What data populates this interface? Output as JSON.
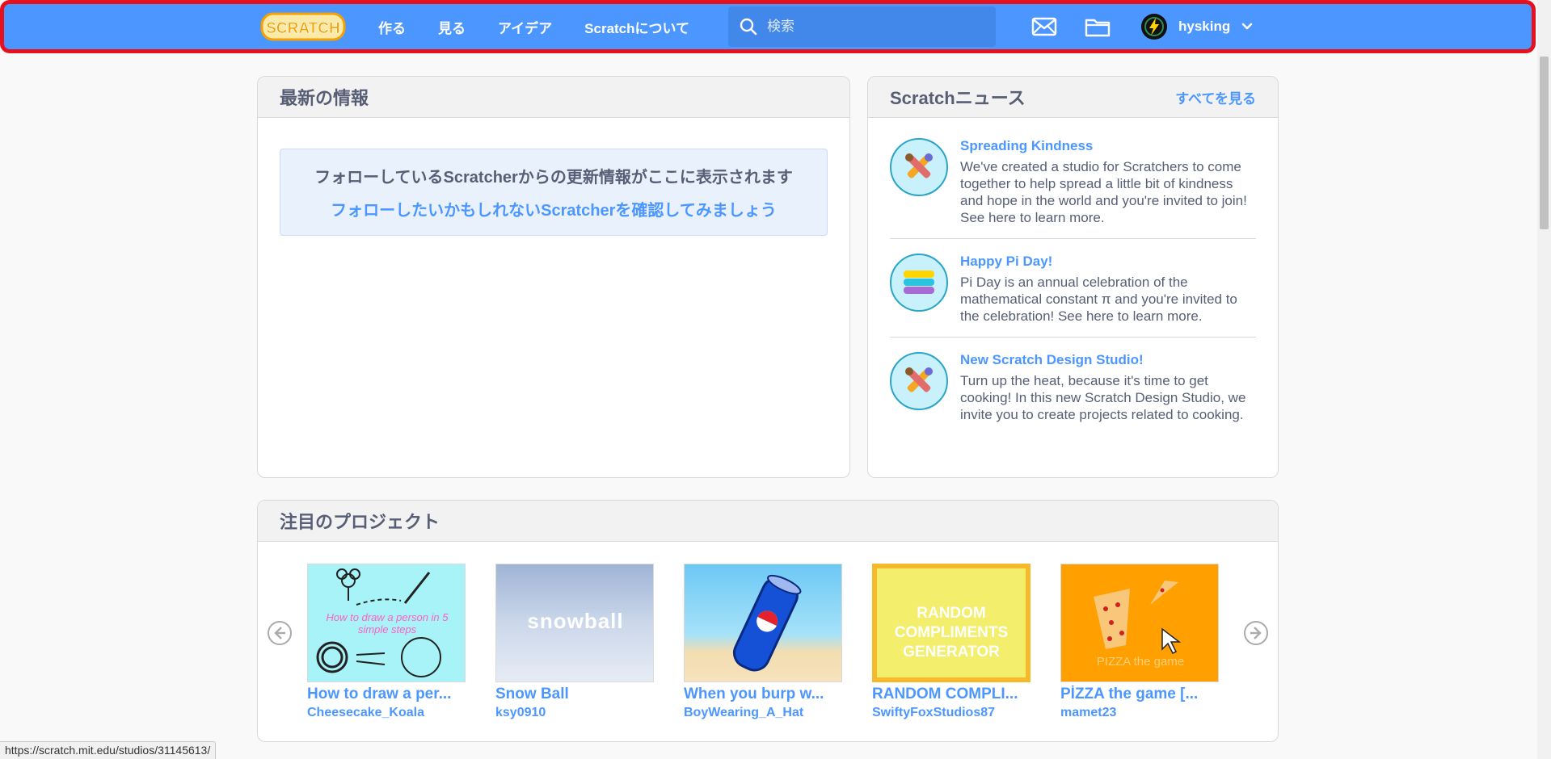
{
  "nav": {
    "logo_text": "SCRATCH",
    "links": [
      "作る",
      "見る",
      "アイデア",
      "Scratchについて"
    ],
    "search_placeholder": "検索",
    "username": "hysking",
    "icons": [
      "messages-icon",
      "my-stuff-folder-icon"
    ]
  },
  "activity": {
    "title": "最新の情報",
    "message_line1": "フォローしているScratcherからの更新情報がここに表示されます",
    "message_line2": "フォローしたいかもしれないScratcherを確認してみましょう"
  },
  "news": {
    "title": "Scratchニュース",
    "see_all": "すべてを見る",
    "items": [
      {
        "title": "Spreading Kindness",
        "desc": "We've created a studio for Scratchers to come together to help spread a little bit of kindness and hope in the world and you're invited to join! See here to learn more."
      },
      {
        "title": "Happy Pi Day!",
        "desc": "Pi Day is an annual celebration of the mathematical constant π and you're invited to the celebration! See here to learn more."
      },
      {
        "title": "New Scratch Design Studio!",
        "desc": "Turn up the heat, because it's time to get cooking! In this new Scratch Design Studio, we invite you to create projects related to cooking."
      }
    ]
  },
  "featured": {
    "title": "注目のプロジェクト",
    "projects": [
      {
        "title": "How to draw a per...",
        "author": "Cheesecake_Koala",
        "thumb_text": "How to draw a person in 5 simple steps"
      },
      {
        "title": "Snow Ball",
        "author": "ksy0910",
        "thumb_text": "snowball"
      },
      {
        "title": "When you burp w...",
        "author": "BoyWearing_A_Hat",
        "thumb_text": ""
      },
      {
        "title": "RANDOM COMPLI...",
        "author": "SwiftyFoxStudios87",
        "thumb_text": "RANDOM COMPLIMENTS GENERATOR"
      },
      {
        "title": "PİZZA the game [...",
        "author": "mamet23",
        "thumb_text": "PIZZA the game"
      }
    ]
  },
  "status_url": "https://scratch.mit.edu/studios/31145613/",
  "colors": {
    "brand_blue": "#4c97ff",
    "highlight_red": "#e5111f",
    "text_gray": "#575e75"
  }
}
